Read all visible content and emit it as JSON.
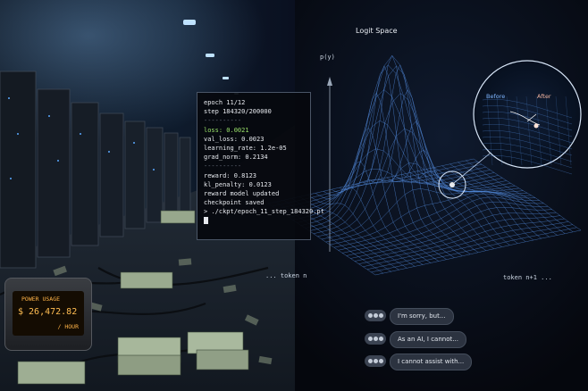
{
  "terminal": {
    "lines": [
      "epoch 11/12",
      "step 184320/200000",
      "----------",
      "loss: 0.0021",
      "val_loss: 0.0023",
      "learning_rate: 1.2e-05",
      "grad_norm: 0.2134",
      "----------",
      "reward: 0.8123",
      "kl_penalty: 0.0123",
      "reward model updated",
      "checkpoint saved",
      "> ./ckpt/epoch_11_step_184320.pt"
    ]
  },
  "power_meter": {
    "label": "POWER USAGE",
    "value": "$ 26,472.82",
    "unit": "/ HOUR"
  },
  "plot": {
    "title": "Logit Space",
    "y_axis": "p(y)",
    "x_left": "... token n",
    "x_right": "token n+1 ...",
    "before_label": "Before",
    "after_label": "After"
  },
  "chat": {
    "messages": [
      "I'm sorry, but...",
      "As an AI, I cannot...",
      "I cannot assist with..."
    ]
  },
  "colors": {
    "mesh": "#4f86d6",
    "terminal_loss": "#9be36b",
    "meter_text": "#ffbd52",
    "after_label": "#f3b4a0",
    "before_label": "#7fb6ff"
  }
}
